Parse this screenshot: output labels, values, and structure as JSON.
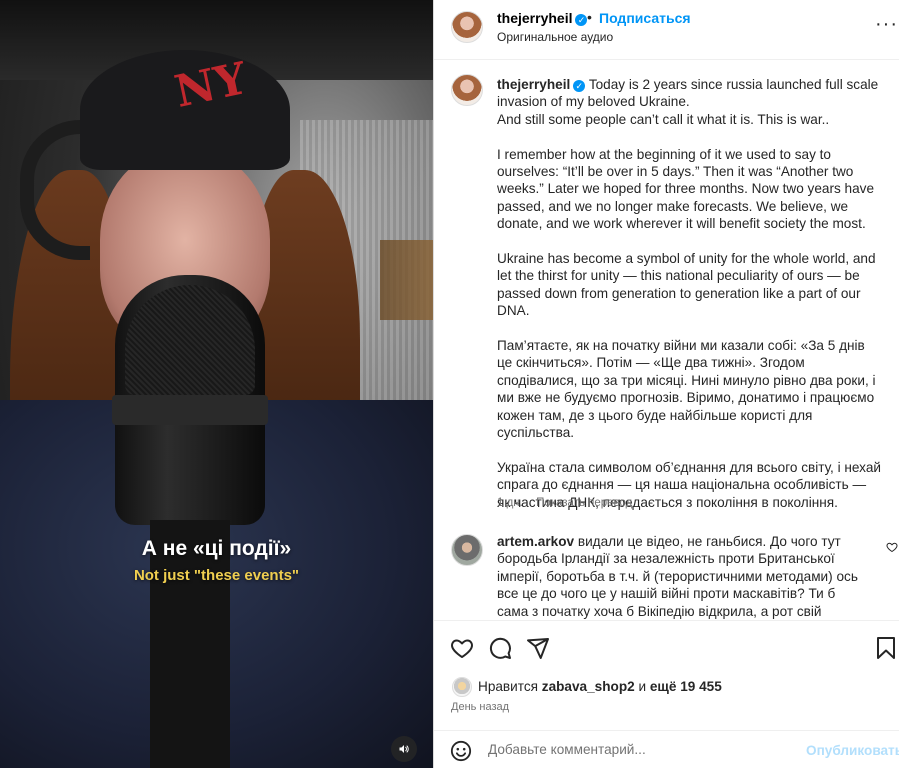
{
  "video": {
    "subtitle_main": "А не «ці події»",
    "subtitle_translation": "Not just \"these events\"",
    "cap_logo": "NY",
    "mute_icon": "speaker-icon"
  },
  "post": {
    "username": "thejerryheil",
    "verified_mark": "✓",
    "dot": "•",
    "follow_label": "Подписаться",
    "audio_label": "Оригинальное аудио",
    "more_icon": "more-horizontal-icon",
    "more_glyph": "···"
  },
  "caption": {
    "username": "thejerryheil",
    "verified_mark": "✓",
    "paragraphs": [
      " Today is 2 years since russia launched full scale invasion of my beloved Ukraine.\nAnd still some people can’t call it what it is. This is war..",
      "I remember how at the beginning of it we used to say to ourselves: “It’ll be over in 5 days.” Then it was “Another two weeks.” Later we hoped for three months. Now two years have passed, and we no longer make forecasts. We believe, we donate, and we work wherever it will benefit society the most.",
      "Ukraine has become a symbol of unity for the whole world, and let the thirst for unity — this national peculiarity of ours — be passed down from generation to generation like a part of our DNA.",
      "Пам’ятаєте, як на початку війни ми казали собі: «За 5 днів це скінчиться». Потім — «Ще два тижні». Згодом сподівалися, що за три місяці. Нині минуло рівно два роки, і ми вже не будуємо прогнозів. Віримо, донатимо і працюємо кожен там, де з цього буде найбільше користі для суспільства.",
      "Україна стала символом об’єднання для всього світу, і нехай спрага до єднання — ця наша національна особливість — як частина ДНК, передається з покоління в покоління."
    ],
    "age": "1 дн.",
    "translate_label": "Показать перевод"
  },
  "comment": {
    "username": "artem.arkov",
    "text": " видали це відео, не ганьбися. До чого тут бородьба Ірландії за незалежність проти Британської імперії, боротьба в т.ч. й (терористичними методами) ось все це до чого це у нашій війні проти маскавітів? Ти б сама з початку хоча б Вікіпедію відкрила, а рот свій закрила",
    "like_icon": "heart-outline-icon"
  },
  "actions": {
    "icons": [
      "heart-outline-icon",
      "comment-icon",
      "share-icon",
      "bookmark-icon"
    ]
  },
  "likes": {
    "prefix": "Нравится ",
    "user": "zabava_shop2",
    "middle": " и ",
    "rest": "ещё 19 455"
  },
  "time_ago": "День назад",
  "add_comment": {
    "placeholder": "Добавьте комментарий...",
    "publish_label": "Опубликовать",
    "emoji_icon": "emoji-icon"
  },
  "colors": {
    "accent": "#0095f6",
    "publish_disabled": "#b2dffc",
    "secondary_text": "#737373",
    "subtitle_yellow": "#f0cf50",
    "cap_logo": "#c0272d"
  }
}
